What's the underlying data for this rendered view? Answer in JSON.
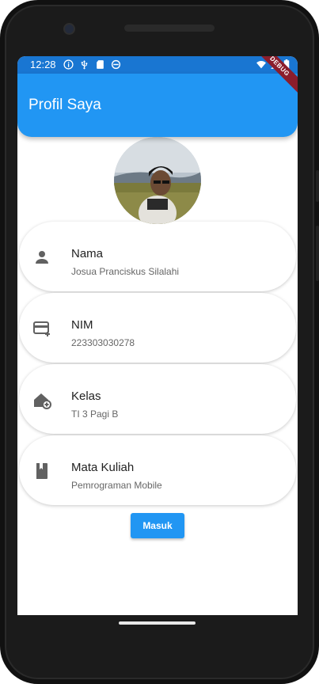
{
  "statusbar": {
    "time": "12:28",
    "left_icons": [
      "info-icon",
      "usb-icon",
      "sd-card-icon",
      "sync-icon"
    ],
    "right_icons": [
      "wifi-icon",
      "signal-icon",
      "battery-icon"
    ]
  },
  "appbar": {
    "title": "Profil Saya",
    "debug_banner": "DEBUG"
  },
  "colors": {
    "appbar": "#2196f3",
    "statusbar": "#1976d2",
    "button": "#2196f3",
    "icon": "#616161"
  },
  "profile": {
    "items": [
      {
        "icon": "person-icon",
        "title": "Nama",
        "value": "Josua Pranciskus Silalahi"
      },
      {
        "icon": "credit-card-icon",
        "title": "NIM",
        "value": "223303030278"
      },
      {
        "icon": "add-home-icon",
        "title": "Kelas",
        "value": "TI 3 Pagi B"
      },
      {
        "icon": "book-icon",
        "title": "Mata Kuliah",
        "value": "Pemrograman Mobile"
      }
    ]
  },
  "button": {
    "label": "Masuk"
  }
}
